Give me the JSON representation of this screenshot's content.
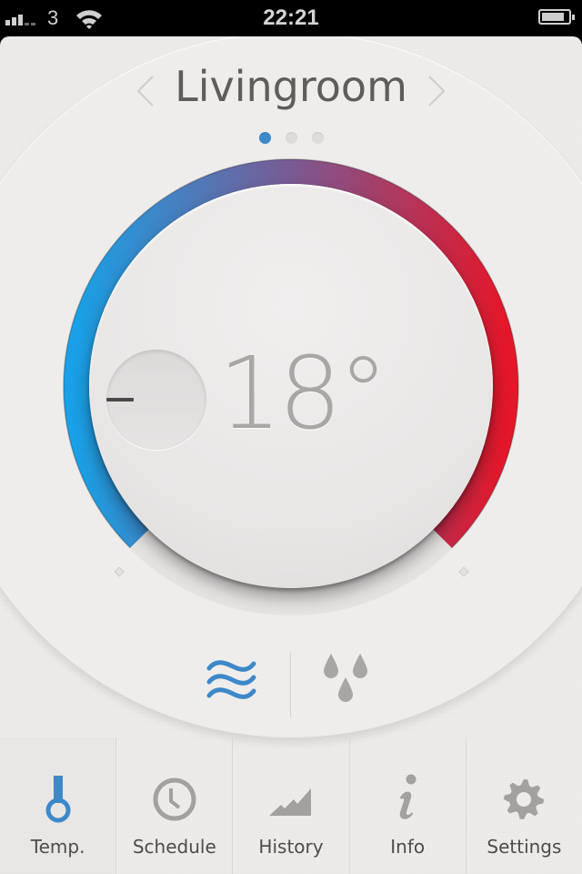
{
  "status_bar": {
    "signal_bars_on": 3,
    "signal_bars_total": 5,
    "carrier": "3",
    "time": "22:21",
    "battery_level": 0.85
  },
  "header": {
    "room_name": "Livingroom",
    "prev_icon": "chevron-left-icon",
    "next_icon": "chevron-right-icon",
    "pages_total": 3,
    "page_active": 1
  },
  "thermostat": {
    "temperature": "18°",
    "decrease_icon": "minus-icon",
    "colors": {
      "cold": "#1aa0e6",
      "mid": "#7a5a93",
      "hot": "#e4172a"
    }
  },
  "modes": [
    {
      "name": "heating",
      "icon": "heat-waves-icon",
      "active": true
    },
    {
      "name": "water",
      "icon": "water-drops-icon",
      "active": false
    }
  ],
  "tabs": [
    {
      "label": "Temp.",
      "icon": "thermometer-icon",
      "active": true
    },
    {
      "label": "Schedule",
      "icon": "clock-icon",
      "active": false
    },
    {
      "label": "History",
      "icon": "chart-icon",
      "active": false
    },
    {
      "label": "Info",
      "icon": "info-icon",
      "active": false
    },
    {
      "label": "Settings",
      "icon": "gear-icon",
      "active": false
    }
  ],
  "accent_color": "#3d88c9",
  "icon_color": "#a3a1a0"
}
